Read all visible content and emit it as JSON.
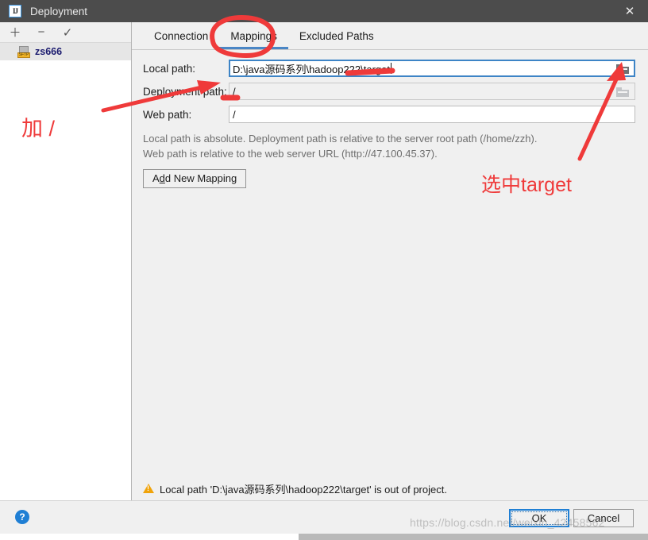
{
  "window": {
    "title": "Deployment",
    "app_icon": "IJ",
    "close_label": "✕"
  },
  "sidebar": {
    "toolbar": [
      {
        "name": "add",
        "glyph": "＋"
      },
      {
        "name": "remove",
        "glyph": "−"
      },
      {
        "name": "apply",
        "glyph": "✓"
      }
    ],
    "items": [
      {
        "label": "zs666",
        "icon": "sftp-server-icon",
        "badge": "SFTP",
        "selected": true
      }
    ]
  },
  "tabs": [
    {
      "label": "Connection",
      "active": false
    },
    {
      "label": "Mappings",
      "active": true
    },
    {
      "label": "Excluded Paths",
      "active": false
    }
  ],
  "form": {
    "local_path": {
      "label": "Local path:",
      "value": "D:\\java源码系列\\hadoop222\\target",
      "focused": true,
      "browse": "folder-icon"
    },
    "deployment_path": {
      "label": "Deployment path:",
      "value": "/",
      "focused": false,
      "browse": "folder-icon-disabled"
    },
    "web_path": {
      "label": "Web path:",
      "value": "/",
      "focused": false
    }
  },
  "hint": {
    "line1": "Local path is absolute. Deployment path is relative to the server root path (/home/zzh).",
    "line2": "Web path is relative to the web server URL (http://47.100.45.37)."
  },
  "add_mapping": {
    "prefix": "A",
    "mnemonic": "d",
    "suffix": "d New Mapping"
  },
  "status": {
    "warning": "Local path 'D:\\java源码系列\\hadoop222\\target' is out of project."
  },
  "footer": {
    "help": "?",
    "ok": "OK",
    "cancel": "Cancel"
  },
  "annotations": {
    "left_note": "加 /",
    "right_note": "选中target",
    "color": "#ef3a3a"
  },
  "watermark": {
    "text": "https://blog.csdn.net/weixin_42458562"
  }
}
